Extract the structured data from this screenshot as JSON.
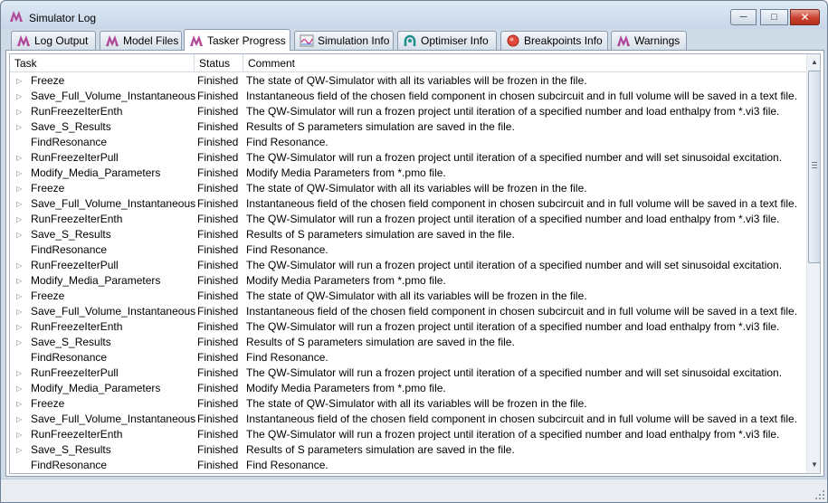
{
  "window": {
    "title": "Simulator Log"
  },
  "caption_buttons": {
    "minimize": "─",
    "maximize": "□",
    "close": "✕"
  },
  "tabs": [
    {
      "label": "Log Output",
      "icon": "qw-logo-icon"
    },
    {
      "label": "Model Files",
      "icon": "qw-logo-icon"
    },
    {
      "label": "Tasker Progress",
      "icon": "qw-logo-icon",
      "active": true
    },
    {
      "label": "Simulation Info",
      "icon": "chart-icon"
    },
    {
      "label": "Optimiser Info",
      "icon": "optimiser-icon"
    },
    {
      "label": "Breakpoints Info",
      "icon": "breakpoint-icon"
    },
    {
      "label": "Warnings",
      "icon": "qw-logo-icon"
    }
  ],
  "table": {
    "columns": [
      "Task",
      "Status",
      "Comment"
    ],
    "rows": [
      {
        "task": "Freeze",
        "status": "Finished",
        "comment": "The state of QW-Simulator with all its variables will be frozen in the file.",
        "expandable": true
      },
      {
        "task": "Save_Full_Volume_Instantaneous",
        "status": "Finished",
        "comment": "Instantaneous field of the chosen field component in chosen subcircuit and in full volume will be saved in a text file.",
        "expandable": true
      },
      {
        "task": "RunFreezeIterEnth",
        "status": "Finished",
        "comment": "The QW-Simulator will run a frozen project until iteration of a specified number and load enthalpy from *.vi3 file.",
        "expandable": true
      },
      {
        "task": "Save_S_Results",
        "status": "Finished",
        "comment": "Results of S parameters simulation are saved in the file.",
        "expandable": true
      },
      {
        "task": "FindResonance",
        "status": "Finished",
        "comment": "Find Resonance.",
        "expandable": false
      },
      {
        "task": "RunFreezeIterPull",
        "status": "Finished",
        "comment": "The QW-Simulator will run a frozen project until iteration of a specified number and will set sinusoidal excitation.",
        "expandable": true
      },
      {
        "task": "Modify_Media_Parameters",
        "status": "Finished",
        "comment": "Modify Media Parameters from *.pmo file.",
        "expandable": true
      },
      {
        "task": "Freeze",
        "status": "Finished",
        "comment": "The state of QW-Simulator with all its variables will be frozen in the file.",
        "expandable": true
      },
      {
        "task": "Save_Full_Volume_Instantaneous",
        "status": "Finished",
        "comment": "Instantaneous field of the chosen field component in chosen subcircuit and in full volume will be saved in a text file.",
        "expandable": true
      },
      {
        "task": "RunFreezeIterEnth",
        "status": "Finished",
        "comment": "The QW-Simulator will run a frozen project until iteration of a specified number and load enthalpy from *.vi3 file.",
        "expandable": true
      },
      {
        "task": "Save_S_Results",
        "status": "Finished",
        "comment": "Results of S parameters simulation are saved in the file.",
        "expandable": true
      },
      {
        "task": "FindResonance",
        "status": "Finished",
        "comment": "Find Resonance.",
        "expandable": false
      },
      {
        "task": "RunFreezeIterPull",
        "status": "Finished",
        "comment": "The QW-Simulator will run a frozen project until iteration of a specified number and will set sinusoidal excitation.",
        "expandable": true
      },
      {
        "task": "Modify_Media_Parameters",
        "status": "Finished",
        "comment": "Modify Media Parameters from *.pmo file.",
        "expandable": true
      },
      {
        "task": "Freeze",
        "status": "Finished",
        "comment": "The state of QW-Simulator with all its variables will be frozen in the file.",
        "expandable": true
      },
      {
        "task": "Save_Full_Volume_Instantaneous",
        "status": "Finished",
        "comment": "Instantaneous field of the chosen field component in chosen subcircuit and in full volume will be saved in a text file.",
        "expandable": true
      },
      {
        "task": "RunFreezeIterEnth",
        "status": "Finished",
        "comment": "The QW-Simulator will run a frozen project until iteration of a specified number and load enthalpy from *.vi3 file.",
        "expandable": true
      },
      {
        "task": "Save_S_Results",
        "status": "Finished",
        "comment": "Results of S parameters simulation are saved in the file.",
        "expandable": true
      },
      {
        "task": "FindResonance",
        "status": "Finished",
        "comment": "Find Resonance.",
        "expandable": false
      },
      {
        "task": "RunFreezeIterPull",
        "status": "Finished",
        "comment": "The QW-Simulator will run a frozen project until iteration of a specified number and will set sinusoidal excitation.",
        "expandable": true
      },
      {
        "task": "Modify_Media_Parameters",
        "status": "Finished",
        "comment": "Modify Media Parameters from *.pmo file.",
        "expandable": true
      },
      {
        "task": "Freeze",
        "status": "Finished",
        "comment": "The state of QW-Simulator with all its variables will be frozen in the file.",
        "expandable": true
      },
      {
        "task": "Save_Full_Volume_Instantaneous",
        "status": "Finished",
        "comment": "Instantaneous field of the chosen field component in chosen subcircuit and in full volume will be saved in a text file.",
        "expandable": true
      },
      {
        "task": "RunFreezeIterEnth",
        "status": "Finished",
        "comment": "The QW-Simulator will run a frozen project until iteration of a specified number and load enthalpy from *.vi3 file.",
        "expandable": true
      },
      {
        "task": "Save_S_Results",
        "status": "Finished",
        "comment": "Results of S parameters simulation are saved in the file.",
        "expandable": true
      },
      {
        "task": "FindResonance",
        "status": "Finished",
        "comment": "Find Resonance.",
        "expandable": false
      }
    ]
  },
  "colors": {
    "qw_logo": "#b0489a",
    "close_button": "#c9412d",
    "window_frame": "#cfdbe7"
  }
}
